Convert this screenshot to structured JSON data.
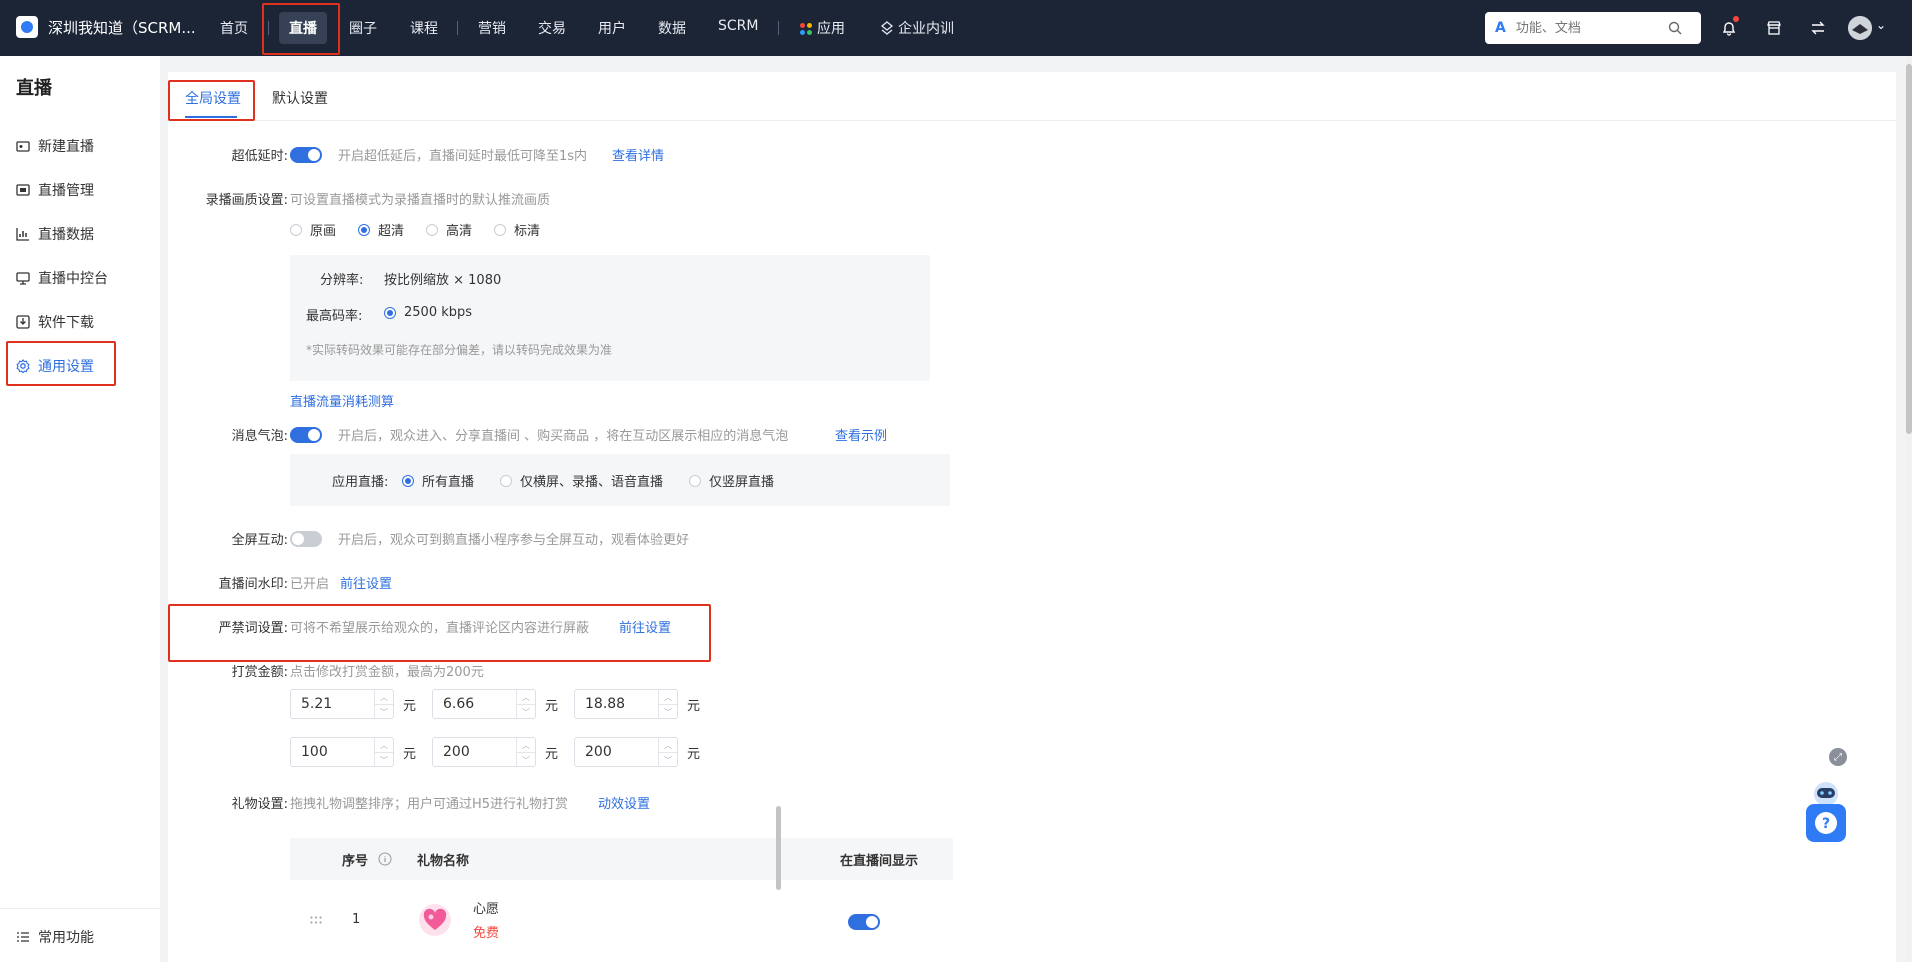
{
  "topbar": {
    "shop_name": "深圳我知道（SCRM...",
    "nav": [
      {
        "label": "首页"
      },
      {
        "label": "直播"
      },
      {
        "label": "圈子"
      },
      {
        "label": "课程"
      },
      {
        "label": "营销"
      },
      {
        "label": "交易"
      },
      {
        "label": "用户"
      },
      {
        "label": "数据"
      },
      {
        "label": "SCRM"
      },
      {
        "label": "应用"
      },
      {
        "label": "企业内训"
      }
    ],
    "search_placeholder": "功能、文档",
    "search_logo": "A"
  },
  "sidebar": {
    "title": "直播",
    "items": [
      {
        "label": "新建直播",
        "icon": "video-plus-icon"
      },
      {
        "label": "直播管理",
        "icon": "live-manage-icon"
      },
      {
        "label": "直播数据",
        "icon": "chart-icon"
      },
      {
        "label": "直播中控台",
        "icon": "monitor-icon"
      },
      {
        "label": "软件下载",
        "icon": "download-icon"
      },
      {
        "label": "通用设置",
        "icon": "gear-icon"
      }
    ],
    "bottom_item": {
      "label": "常用功能",
      "icon": "list-icon"
    }
  },
  "tabs": [
    {
      "label": "全局设置"
    },
    {
      "label": "默认设置"
    }
  ],
  "settings": {
    "low_latency": {
      "label": "超低延时:",
      "hint": "开启超低延后，直播间延时最低可降至1s内",
      "link": "查看详情",
      "enabled": true
    },
    "record_quality": {
      "label": "录播画质设置:",
      "hint": "可设置直播模式为录播直播时的默认推流画质",
      "options": [
        "原画",
        "超清",
        "高清",
        "标清"
      ],
      "selected": "超清",
      "resolution_label": "分辨率:",
      "resolution_value": "按比例缩放 × 1080",
      "bitrate_label": "最高码率:",
      "bitrate_value": "2500 kbps",
      "note": "*实际转码效果可能存在部分偏差，请以转码完成效果为准",
      "calc_link": "直播流量消耗测算"
    },
    "message_bubble": {
      "label": "消息气泡:",
      "hint": "开启后，观众进入、分享直播间 、购买商品 ，将在互动区展示相应的消息气泡",
      "link": "查看示例",
      "enabled": true,
      "apply_label": "应用直播:",
      "apply_options": [
        "所有直播",
        "仅横屏、录播、语音直播",
        "仅竖屏直播"
      ],
      "apply_selected": "所有直播"
    },
    "fullscreen": {
      "label": "全屏互动:",
      "hint": "开启后，观众可到鹅直播小程序参与全屏互动，观看体验更好",
      "enabled": false
    },
    "watermark": {
      "label": "直播间水印:",
      "status": "已开启",
      "link": "前往设置"
    },
    "banned_words": {
      "label": "严禁词设置:",
      "hint": "可将不希望展示给观众的，直播评论区内容进行屏蔽",
      "link": "前往设置"
    },
    "tip_amount": {
      "label": "打赏金额:",
      "hint": "点击修改打赏金额，最高为200元",
      "values": [
        "5.21",
        "6.66",
        "18.88",
        "100",
        "200",
        "200"
      ],
      "unit": "元"
    },
    "gifts": {
      "label": "礼物设置:",
      "hint": "拖拽礼物调整排序；用户可通过H5进行礼物打赏",
      "link": "动效设置",
      "columns": [
        "序号",
        "礼物名称",
        "在直播间显示"
      ],
      "rows": [
        {
          "index": "1",
          "name": "心愿",
          "price": "免费",
          "show": true
        }
      ]
    }
  },
  "colors": {
    "topbar_bg": "#1c2536",
    "primary": "#2f6fe0",
    "highlight": "#e0301e",
    "price_red": "#f5483b"
  }
}
